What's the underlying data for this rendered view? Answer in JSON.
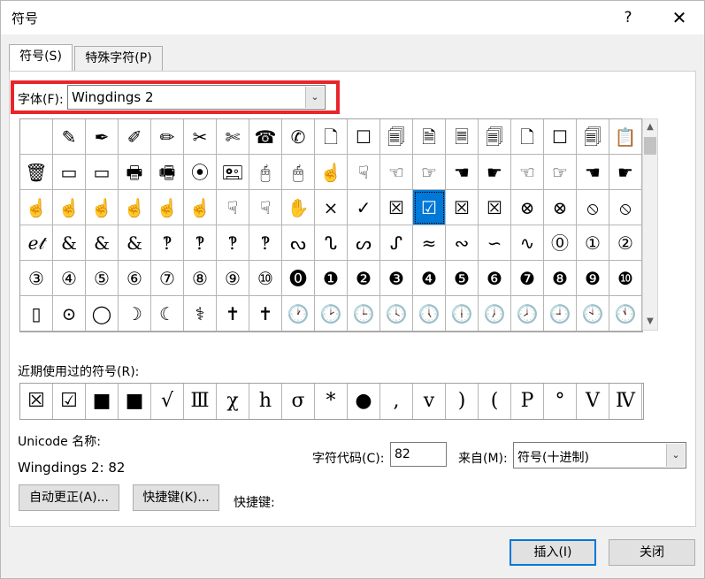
{
  "window": {
    "title": "符号",
    "help": "?",
    "close": "✕"
  },
  "tabs": {
    "symbols": "符号(S)",
    "special": "特殊字符(P)"
  },
  "font": {
    "label": "字体(F):",
    "value": "Wingdings 2",
    "arrow": "⌄"
  },
  "grid": {
    "rows": [
      [
        "",
        "✎",
        "✒",
        "✐",
        "✏",
        "✂",
        "✄",
        "☎",
        "✆",
        "🗋",
        "☐",
        "🗐",
        "🗎",
        "🗏",
        "🗐",
        "🗋",
        "☐",
        "🗐",
        "📋"
      ],
      [
        "🗑",
        "▭",
        "▭",
        "🖶",
        "🖷",
        "⦿",
        "🖭",
        "🖰",
        "🖱",
        "☝",
        "☟",
        "☜",
        "☞",
        "☚",
        "☛",
        "☜",
        "☞",
        "☚",
        "☛"
      ],
      [
        "☝",
        "☝",
        "☝",
        "☝",
        "☝",
        "☝",
        "☟",
        "☟",
        "✋",
        "×",
        "✓",
        "☒",
        "☑",
        "☒",
        "☒",
        "⊗",
        "⊗",
        "⦸",
        "⦸"
      ],
      [
        "ℯ𝓉",
        "&",
        "&",
        "&",
        "‽",
        "‽",
        "‽",
        "‽",
        "ᔓ",
        "ᔐ",
        "ᔕ",
        "ᔑ",
        "≈",
        "∾",
        "∽",
        "∿",
        "⓪",
        "①",
        "②"
      ],
      [
        "③",
        "④",
        "⑤",
        "⑥",
        "⑦",
        "⑧",
        "⑨",
        "⑩",
        "⓿",
        "❶",
        "❷",
        "❸",
        "❹",
        "❺",
        "❻",
        "❼",
        "❽",
        "❾",
        "❿"
      ],
      [
        "▯",
        "⊙",
        "◯",
        "☽",
        "☾",
        "⚕",
        "✝",
        "✝",
        "🕐",
        "🕑",
        "🕒",
        "🕓",
        "🕔",
        "🕕",
        "🕖",
        "🕗",
        "🕘",
        "🕙",
        "🕚"
      ]
    ]
  },
  "recent": {
    "label": "近期使用过的符号(R):",
    "items": [
      "☒",
      "☑",
      "■",
      "■",
      "√",
      "Ⅲ",
      "χ",
      "h",
      "σ",
      "*",
      "●",
      ",",
      "v",
      ")",
      "(",
      "P",
      "°",
      "Ⅴ",
      "Ⅳ"
    ]
  },
  "unicode": {
    "name_label": "Unicode 名称:",
    "value": "Wingdings 2: 82"
  },
  "code": {
    "label": "字符代码(C):",
    "value": "82"
  },
  "from": {
    "label": "来自(M):",
    "value": "符号(十进制)",
    "arrow": "⌄"
  },
  "buttons": {
    "autocorrect": "自动更正(A)...",
    "shortcut": "快捷键(K)...",
    "shortcut_label": "快捷键:",
    "insert": "插入(I)",
    "close": "关闭"
  },
  "scroll": {
    "up": "▲",
    "down": "▼"
  },
  "colors": {
    "accent": "#0078d7",
    "highlight_box": "#e8252a"
  }
}
